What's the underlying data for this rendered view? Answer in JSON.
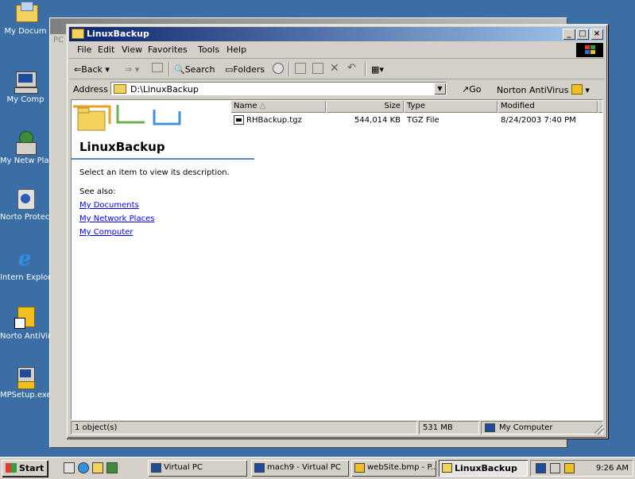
{
  "desktop": {
    "icons": [
      {
        "label": "My Docum",
        "icon": "folder-documents-icon"
      },
      {
        "label": "My Comp",
        "icon": "computer-icon"
      },
      {
        "label": "My Netw Place",
        "icon": "network-icon"
      },
      {
        "label": "Norto Protect",
        "icon": "norton-protect-icon"
      },
      {
        "label": "Intern Explor",
        "icon": "internet-explorer-icon"
      },
      {
        "label": "Norto AntiVirus",
        "icon": "norton-antivirus-icon"
      },
      {
        "label": "MPSetup.exe",
        "icon": "setup-icon"
      }
    ],
    "background_color": "#3a6ea5"
  },
  "background_window": {
    "partial_label": "PC"
  },
  "window": {
    "title": "LinuxBackup",
    "menu": [
      "File",
      "Edit",
      "View",
      "Favorites",
      "Tools",
      "Help"
    ],
    "toolbar": {
      "back": "Back",
      "search": "Search",
      "folders": "Folders"
    },
    "address": {
      "label": "Address",
      "value": "D:\\LinuxBackup",
      "go": "Go",
      "norton": "Norton AntiVirus"
    },
    "webview": {
      "title": "LinuxBackup",
      "description": "Select an item to view its description.",
      "see_also": "See also:",
      "links": [
        "My Documents",
        "My Network Places",
        "My Computer"
      ]
    },
    "columns": [
      "Name",
      "Size",
      "Type",
      "Modified"
    ],
    "files": [
      {
        "name": "RHBackup.tgz",
        "size": "544,014 KB",
        "type": "TGZ File",
        "modified": "8/24/2003 7:40 PM"
      }
    ],
    "status": {
      "objects": "1 object(s)",
      "size": "531 MB",
      "zone": "My Computer"
    }
  },
  "taskbar": {
    "start": "Start",
    "tasks": [
      {
        "label": "Virtual PC",
        "active": false
      },
      {
        "label": "mach9 - Virtual PC",
        "active": false
      },
      {
        "label": "webSite.bmp - P...",
        "active": false
      },
      {
        "label": "LinuxBackup",
        "active": true
      }
    ],
    "clock": "9:26 AM"
  },
  "colors": {
    "titlebar_active": "#0a246a",
    "link": "#0000ee",
    "chrome": "#d4d0c8"
  }
}
